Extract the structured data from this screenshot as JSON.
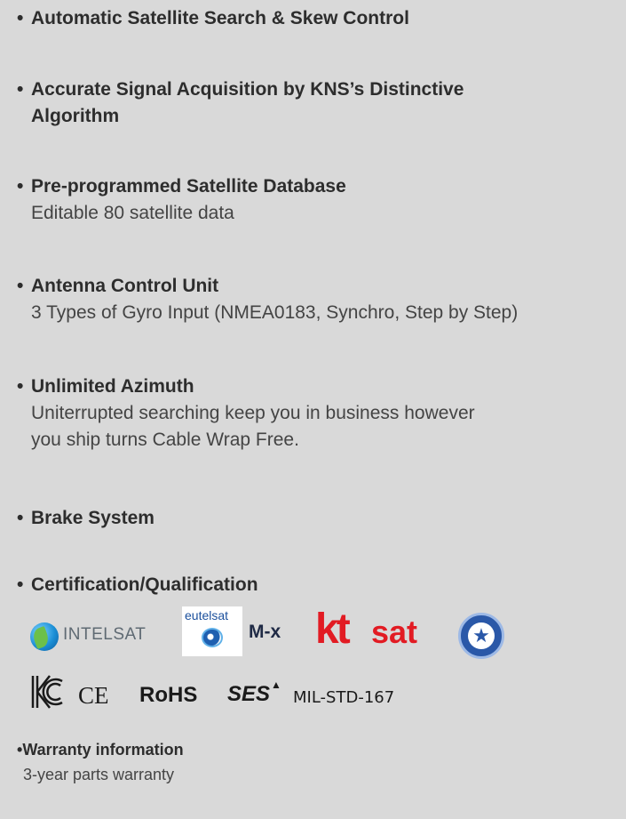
{
  "bullet": "•",
  "features": [
    {
      "title": "Automatic Satellite Search & Skew Control"
    },
    {
      "title": "Accurate Signal Acquisition by KNS’s Distinctive",
      "title_line2": "Algorithm"
    },
    {
      "title": "Pre-programmed Satellite Database",
      "desc": "Editable 80 satellite data"
    },
    {
      "title": "Antenna Control Unit",
      "desc": "3 Types of Gyro Input (NMEA0183, Synchro, Step by Step)"
    },
    {
      "title": "Unlimited Azimuth",
      "desc": "Uniterrupted searching keep you in business however",
      "desc_line2": "you ship turns Cable Wrap Free."
    },
    {
      "title": "Brake System"
    },
    {
      "title": "Certification/Qualification"
    }
  ],
  "certifications": {
    "intelsat": "INTELSAT",
    "eutelsat": "eutelsat",
    "mx": "M-x",
    "kt": "kt",
    "ktsat": "sat",
    "ce": "CE",
    "rohs": "RoHS",
    "ses": "SES",
    "ses_mark": "▲",
    "mil": "MIL-STD-167"
  },
  "warranty": {
    "title": "Warranty information",
    "desc": "3-year parts warranty"
  }
}
